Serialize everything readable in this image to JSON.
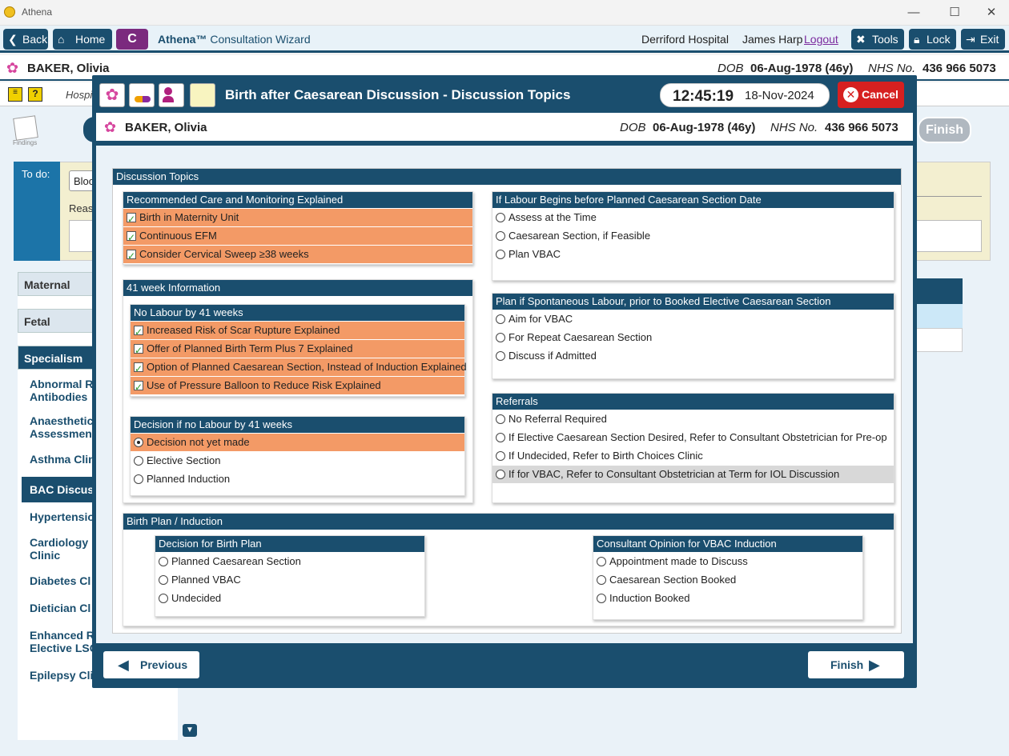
{
  "window": {
    "title": "Athena",
    "minimize": "—",
    "maximize": "☐",
    "close": "✕"
  },
  "toolbar": {
    "back": "Back",
    "home": "Home",
    "c_button": "C",
    "brand": "Athena™",
    "wizard": "Consultation Wizard",
    "hospital": "Derriford Hospital",
    "user": "James Harp",
    "logout": "Logout",
    "tools": "Tools",
    "lock": "Lock",
    "exit": "Exit"
  },
  "patient": {
    "name": "BAKER, Olivia",
    "dob_label": "DOB",
    "dob": "06-Aug-1978 (46y)",
    "nhs_label": "NHS No.",
    "nhs": "436 966 5073"
  },
  "background": {
    "hosp_partial": "Hospi",
    "findings": "Findings",
    "todo_label": "To do:",
    "todo_item": "Bloo",
    "reason_partial": "Reaso",
    "finish": "Finish",
    "sidebar": {
      "maternal": "Maternal",
      "fetal": "Fetal",
      "specialism": "Specialism",
      "items": [
        "Abnormal R",
        "Antibodies",
        "Anaesthetic",
        "Assessment",
        "Asthma Clin",
        "BAC Discuss",
        "Hypertensio",
        "Cardiology",
        "Clinic",
        "Diabetes Cl",
        "Dietician Cl",
        "Enhanced R",
        "Elective LSCS",
        "Epilepsy Clinic"
      ]
    }
  },
  "modal": {
    "title": "Birth after Caesarean Discussion - Discussion Topics",
    "time": "12:45:19",
    "date": "18-Nov-2024",
    "cancel": "Cancel",
    "previous": "Previous",
    "finish": "Finish"
  },
  "discussion": {
    "header": "Discussion Topics",
    "recommended": {
      "header": "Recommended Care and Monitoring Explained",
      "items": [
        "Birth in Maternity Unit",
        "Continuous EFM",
        "Consider Cervical Sweep ≥38 weeks"
      ]
    },
    "week41": {
      "header": "41 week Information",
      "no_labour": {
        "header": "No Labour by 41 weeks",
        "items": [
          "Increased Risk of Scar Rupture Explained",
          "Offer of Planned Birth Term Plus 7 Explained",
          "Option of Planned Caesarean Section, Instead of Induction Explained",
          "Use of Pressure Balloon to Reduce Risk Explained"
        ]
      },
      "decision": {
        "header": "Decision if no Labour by 41 weeks",
        "options": [
          "Decision not yet made",
          "Elective Section",
          "Planned Induction"
        ],
        "selected": 0
      }
    },
    "labour_before": {
      "header": "If Labour Begins before Planned Caesarean Section Date",
      "options": [
        "Assess at the Time",
        "Caesarean Section, if Feasible",
        "Plan VBAC"
      ]
    },
    "spontaneous": {
      "header": "Plan if Spontaneous Labour, prior to Booked Elective Caesarean Section",
      "options": [
        "Aim for VBAC",
        "For Repeat Caesarean Section",
        "Discuss if Admitted"
      ]
    },
    "referrals": {
      "header": "Referrals",
      "options": [
        "No Referral Required",
        "If Elective Caesarean Section Desired, Refer to Consultant Obstetrician for Pre-op",
        "If Undecided, Refer to Birth Choices Clinic",
        "If for VBAC, Refer to Consultant Obstetrician at Term for IOL Discussion"
      ]
    },
    "birth_plan": {
      "header": "Birth Plan / Induction",
      "decision": {
        "header": "Decision for Birth Plan",
        "options": [
          "Planned Caesarean Section",
          "Planned VBAC",
          "Undecided"
        ]
      },
      "consultant": {
        "header": "Consultant Opinion for VBAC Induction",
        "options": [
          "Appointment made to Discuss",
          "Caesarean Section Booked",
          "Induction Booked"
        ]
      }
    }
  }
}
